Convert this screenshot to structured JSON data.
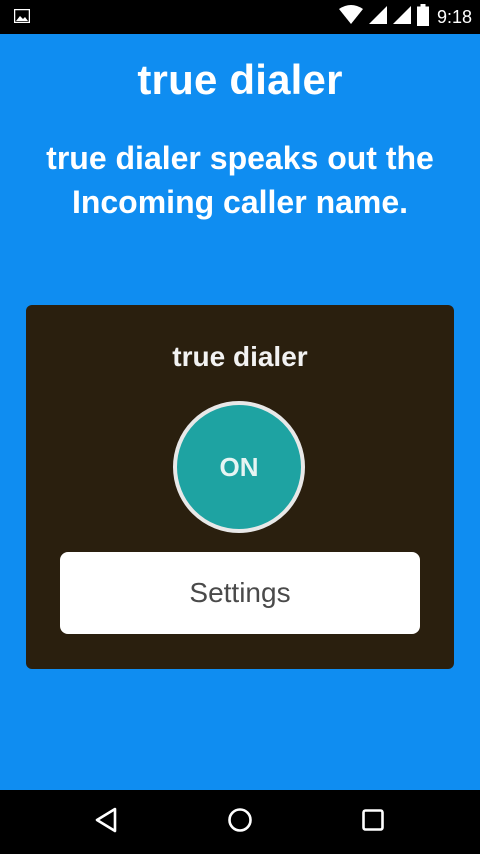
{
  "status_bar": {
    "time": "9:18",
    "icons": [
      "image-notification-icon",
      "wifi-icon",
      "signal-icon",
      "signal-icon",
      "battery-icon"
    ]
  },
  "app": {
    "title": "true dialer",
    "tagline": "true dialer speaks out the Incoming caller name."
  },
  "card": {
    "title": "true dialer",
    "toggle_label": "ON",
    "settings_label": "Settings"
  },
  "nav": {
    "icons": [
      "back-icon",
      "home-icon",
      "recents-icon"
    ]
  },
  "colors": {
    "background": "#0f8df1",
    "card": "#2a1f0e",
    "toggle": "#1ea3a2",
    "button": "#ffffff"
  }
}
